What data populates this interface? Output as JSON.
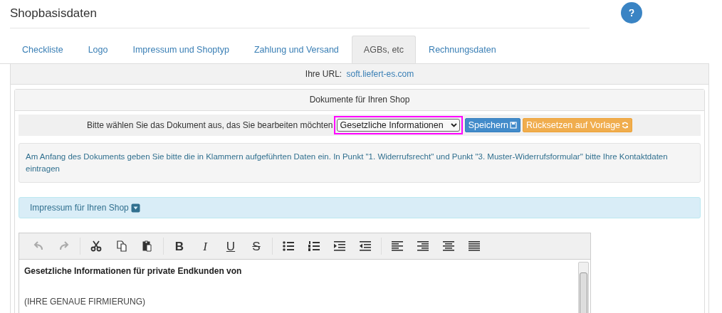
{
  "page": {
    "title": "Shopbasisdaten"
  },
  "tabs": [
    {
      "label": "Checkliste",
      "selected": false
    },
    {
      "label": "Logo",
      "selected": false
    },
    {
      "label": "Impressum und Shoptyp",
      "selected": false
    },
    {
      "label": "Zahlung und Versand",
      "selected": false
    },
    {
      "label": "AGBs, etc",
      "selected": true
    },
    {
      "label": "Rechnungsdaten",
      "selected": false
    }
  ],
  "url_bar": {
    "label": "Ihre URL:",
    "link": "soft.liefert-es.com"
  },
  "documents_panel": {
    "heading": "Dokumente für Ihren Shop",
    "prompt": "Bitte wählen Sie das Dokument aus, das Sie bearbeiten möchten",
    "select_value": "Gesetzliche Informationen",
    "save_button": "Speichern",
    "reset_button": "Rücksetzen auf Vorlage",
    "info": "Am Anfang des Dokuments geben Sie bitte die in Klammern aufgeführten Daten ein. In Punkt \"1. Widerrufsrecht\" und Punkt \"3. Muster-Widerrufsformular\" bitte Ihre Kontaktdaten eintragen",
    "section": {
      "label": "Impressum für Ihren Shop",
      "expanded": false
    }
  },
  "editor": {
    "toolbar": [
      [
        {
          "disabled": true
        },
        {
          "disabled": true
        }
      ],
      [
        {
          "disabled": false
        },
        {
          "disabled": false
        },
        {
          "disabled": false
        }
      ],
      [
        {
          "disabled": false,
          "label": "B"
        },
        {
          "disabled": false,
          "label": "I"
        },
        {
          "disabled": false,
          "label": "U"
        },
        {
          "disabled": false,
          "label": "S"
        }
      ],
      [
        {
          "disabled": false
        },
        {
          "disabled": false
        },
        {
          "disabled": false
        },
        {
          "disabled": false
        }
      ],
      [
        {
          "disabled": false
        },
        {
          "disabled": false
        },
        {
          "disabled": false
        },
        {
          "disabled": false
        }
      ]
    ],
    "lines": [
      {
        "kind": "bold",
        "text": "Gesetzliche Informationen für private Endkunden von"
      },
      {
        "kind": "blank"
      },
      {
        "kind": "plain",
        "text": "(IHRE GENAUE FIRMIERUNG)"
      }
    ]
  }
}
